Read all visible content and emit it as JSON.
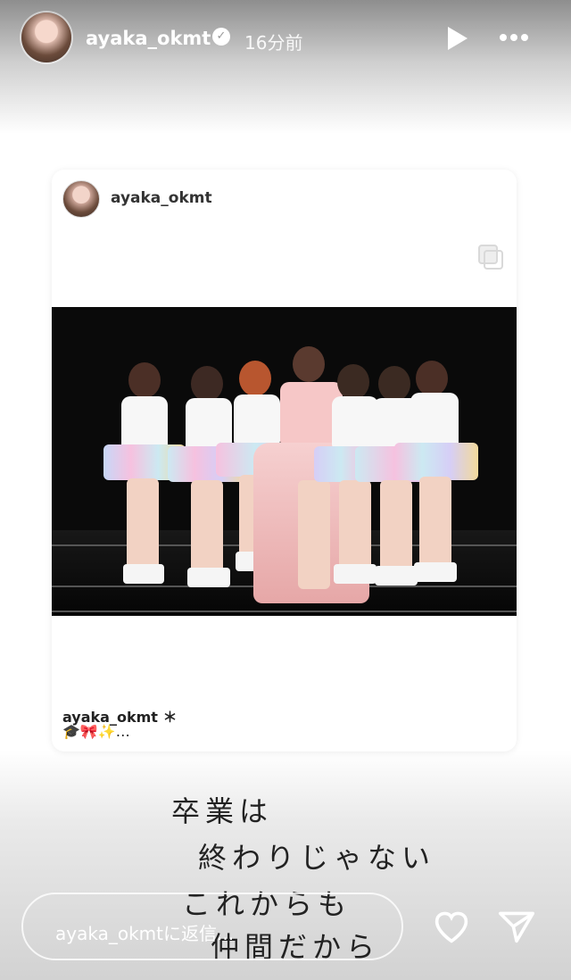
{
  "header": {
    "username": "ayaka_okmt",
    "verified_icon": "verified-badge-icon",
    "time": "16分前",
    "play_icon": "play-icon",
    "more_icon": "more-icon"
  },
  "post_card": {
    "username": "ayaka_okmt",
    "caption_user": "ayaka_okmt ＊",
    "caption_line": "🎓🎀✨…"
  },
  "handwriting": {
    "line1": "卒業は",
    "line2": "終わりじゃない",
    "line3": "これからも",
    "line4": "仲間だから"
  },
  "reply": {
    "placeholder": "ayaka_okmtに返信..."
  }
}
